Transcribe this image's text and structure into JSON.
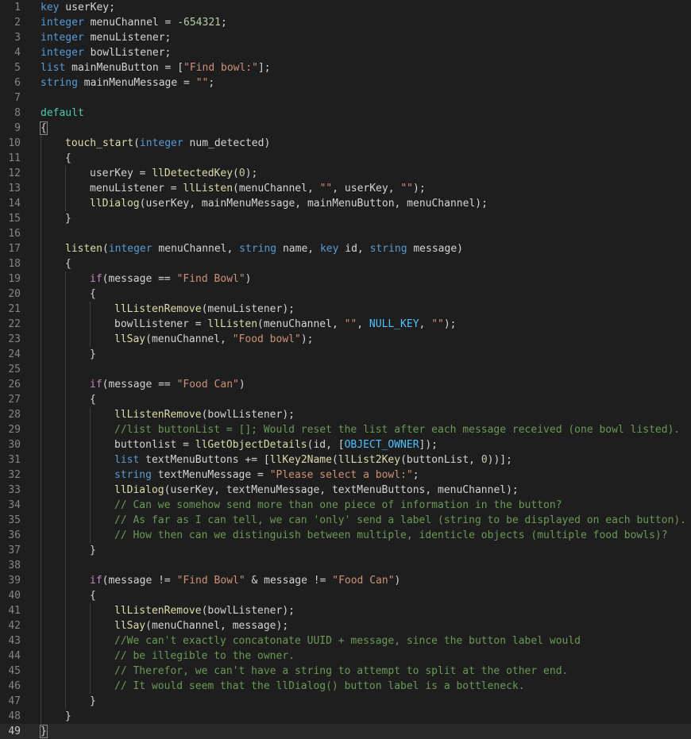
{
  "editor": {
    "language": "LSL",
    "colors": {
      "background": "#1e1e1e",
      "line_number": "#858585",
      "keyword_type": "#569cd6",
      "control": "#c586c0",
      "function": "#dcdcaa",
      "string": "#ce9178",
      "number": "#b5cea8",
      "comment": "#6a9955",
      "constant": "#4fc1ff",
      "state": "#4ec9b0"
    },
    "current_line": 49,
    "lines": [
      {
        "n": "1",
        "indent": 0,
        "tokens": [
          [
            "kw",
            "key"
          ],
          [
            "plain",
            " userKey;"
          ]
        ]
      },
      {
        "n": "2",
        "indent": 0,
        "tokens": [
          [
            "kw",
            "integer"
          ],
          [
            "plain",
            " menuChannel = "
          ],
          [
            "num",
            "-654321"
          ],
          [
            "plain",
            ";"
          ]
        ]
      },
      {
        "n": "3",
        "indent": 0,
        "tokens": [
          [
            "kw",
            "integer"
          ],
          [
            "plain",
            " menuListener;"
          ]
        ]
      },
      {
        "n": "4",
        "indent": 0,
        "tokens": [
          [
            "kw",
            "integer"
          ],
          [
            "plain",
            " bowlListener;"
          ]
        ]
      },
      {
        "n": "5",
        "indent": 0,
        "tokens": [
          [
            "kw",
            "list"
          ],
          [
            "plain",
            " mainMenuButton = ["
          ],
          [
            "str",
            "\"Find bowl:\""
          ],
          [
            "plain",
            "];"
          ]
        ]
      },
      {
        "n": "6",
        "indent": 0,
        "tokens": [
          [
            "kw",
            "string"
          ],
          [
            "plain",
            " mainMenuMessage = "
          ],
          [
            "str",
            "\"\""
          ],
          [
            "plain",
            ";"
          ]
        ]
      },
      {
        "n": "7",
        "indent": 0,
        "tokens": []
      },
      {
        "n": "8",
        "indent": 0,
        "tokens": [
          [
            "state",
            "default"
          ]
        ]
      },
      {
        "n": "9",
        "indent": 0,
        "tokens": [
          [
            "plain",
            "{"
          ]
        ],
        "match": true
      },
      {
        "n": "10",
        "indent": 1,
        "tokens": [
          [
            "ev",
            "touch_start"
          ],
          [
            "plain",
            "("
          ],
          [
            "kw",
            "integer"
          ],
          [
            "plain",
            " num_detected)"
          ]
        ]
      },
      {
        "n": "11",
        "indent": 1,
        "tokens": [
          [
            "plain",
            "{"
          ]
        ]
      },
      {
        "n": "12",
        "indent": 2,
        "tokens": [
          [
            "plain",
            "userKey = "
          ],
          [
            "fn",
            "llDetectedKey"
          ],
          [
            "plain",
            "("
          ],
          [
            "num",
            "0"
          ],
          [
            "plain",
            ");"
          ]
        ]
      },
      {
        "n": "13",
        "indent": 2,
        "tokens": [
          [
            "plain",
            "menuListener = "
          ],
          [
            "fn",
            "llListen"
          ],
          [
            "plain",
            "(menuChannel, "
          ],
          [
            "str",
            "\"\""
          ],
          [
            "plain",
            ", userKey, "
          ],
          [
            "str",
            "\"\""
          ],
          [
            "plain",
            ");"
          ]
        ]
      },
      {
        "n": "14",
        "indent": 2,
        "tokens": [
          [
            "fn",
            "llDialog"
          ],
          [
            "plain",
            "(userKey, mainMenuMessage, mainMenuButton, menuChannel);"
          ]
        ]
      },
      {
        "n": "15",
        "indent": 1,
        "tokens": [
          [
            "plain",
            "}"
          ]
        ]
      },
      {
        "n": "16",
        "indent": 0,
        "guides": 1,
        "tokens": []
      },
      {
        "n": "17",
        "indent": 1,
        "tokens": [
          [
            "ev",
            "listen"
          ],
          [
            "plain",
            "("
          ],
          [
            "kw",
            "integer"
          ],
          [
            "plain",
            " menuChannel, "
          ],
          [
            "kw",
            "string"
          ],
          [
            "plain",
            " name, "
          ],
          [
            "kw",
            "key"
          ],
          [
            "plain",
            " id, "
          ],
          [
            "kw",
            "string"
          ],
          [
            "plain",
            " message)"
          ]
        ]
      },
      {
        "n": "18",
        "indent": 1,
        "tokens": [
          [
            "plain",
            "{"
          ]
        ]
      },
      {
        "n": "19",
        "indent": 2,
        "tokens": [
          [
            "ctl",
            "if"
          ],
          [
            "plain",
            "(message == "
          ],
          [
            "str",
            "\"Find Bowl\""
          ],
          [
            "plain",
            ")"
          ]
        ]
      },
      {
        "n": "20",
        "indent": 2,
        "tokens": [
          [
            "plain",
            "{"
          ]
        ]
      },
      {
        "n": "21",
        "indent": 3,
        "tokens": [
          [
            "fn",
            "llListenRemove"
          ],
          [
            "plain",
            "(menuListener);"
          ]
        ]
      },
      {
        "n": "22",
        "indent": 3,
        "tokens": [
          [
            "plain",
            "bowlListener = "
          ],
          [
            "fn",
            "llListen"
          ],
          [
            "plain",
            "(menuChannel, "
          ],
          [
            "str",
            "\"\""
          ],
          [
            "plain",
            ", "
          ],
          [
            "const",
            "NULL_KEY"
          ],
          [
            "plain",
            ", "
          ],
          [
            "str",
            "\"\""
          ],
          [
            "plain",
            ");"
          ]
        ]
      },
      {
        "n": "23",
        "indent": 3,
        "tokens": [
          [
            "fn",
            "llSay"
          ],
          [
            "plain",
            "(menuChannel, "
          ],
          [
            "str",
            "\"Food bowl\""
          ],
          [
            "plain",
            ");"
          ]
        ]
      },
      {
        "n": "24",
        "indent": 2,
        "tokens": [
          [
            "plain",
            "}"
          ]
        ]
      },
      {
        "n": "25",
        "indent": 0,
        "guides": 2,
        "tokens": []
      },
      {
        "n": "26",
        "indent": 2,
        "tokens": [
          [
            "ctl",
            "if"
          ],
          [
            "plain",
            "(message == "
          ],
          [
            "str",
            "\"Food Can\""
          ],
          [
            "plain",
            ")"
          ]
        ]
      },
      {
        "n": "27",
        "indent": 2,
        "tokens": [
          [
            "plain",
            "{"
          ]
        ]
      },
      {
        "n": "28",
        "indent": 3,
        "tokens": [
          [
            "fn",
            "llListenRemove"
          ],
          [
            "plain",
            "(bowlListener);"
          ]
        ]
      },
      {
        "n": "29",
        "indent": 3,
        "tokens": [
          [
            "cmt",
            "//list buttonList = []; Would reset the list after each message received (one bowl listed)."
          ]
        ]
      },
      {
        "n": "30",
        "indent": 3,
        "tokens": [
          [
            "plain",
            "buttonlist = "
          ],
          [
            "fn",
            "llGetObjectDetails"
          ],
          [
            "plain",
            "(id, ["
          ],
          [
            "const",
            "OBJECT_OWNER"
          ],
          [
            "plain",
            "]);"
          ]
        ]
      },
      {
        "n": "31",
        "indent": 3,
        "tokens": [
          [
            "kw",
            "list"
          ],
          [
            "plain",
            " textMenuButtons += ["
          ],
          [
            "fn",
            "llKey2Name"
          ],
          [
            "plain",
            "("
          ],
          [
            "fn",
            "llList2Key"
          ],
          [
            "plain",
            "(buttonList, "
          ],
          [
            "num",
            "0"
          ],
          [
            "plain",
            "))];"
          ]
        ]
      },
      {
        "n": "32",
        "indent": 3,
        "tokens": [
          [
            "kw",
            "string"
          ],
          [
            "plain",
            " textMenuMessage = "
          ],
          [
            "str",
            "\"Please select a bowl:\""
          ],
          [
            "plain",
            ";"
          ]
        ]
      },
      {
        "n": "33",
        "indent": 3,
        "tokens": [
          [
            "fn",
            "llDialog"
          ],
          [
            "plain",
            "(userKey, textMenuMessage, textMenuButtons, menuChannel);"
          ]
        ]
      },
      {
        "n": "34",
        "indent": 3,
        "tokens": [
          [
            "cmt",
            "// Can we somehow send more than one piece of information in the button?"
          ]
        ]
      },
      {
        "n": "35",
        "indent": 3,
        "tokens": [
          [
            "cmt",
            "// As far as I can tell, we can 'only' send a label (string to be displayed on each button)."
          ]
        ]
      },
      {
        "n": "36",
        "indent": 3,
        "tokens": [
          [
            "cmt",
            "// How then can we distinguish between multiple, identicle objects (multiple food bowls)?"
          ]
        ]
      },
      {
        "n": "37",
        "indent": 2,
        "tokens": [
          [
            "plain",
            "}"
          ]
        ]
      },
      {
        "n": "38",
        "indent": 0,
        "guides": 2,
        "tokens": []
      },
      {
        "n": "39",
        "indent": 2,
        "tokens": [
          [
            "ctl",
            "if"
          ],
          [
            "plain",
            "(message != "
          ],
          [
            "str",
            "\"Find Bowl\""
          ],
          [
            "plain",
            " & message != "
          ],
          [
            "str",
            "\"Food Can\""
          ],
          [
            "plain",
            ")"
          ]
        ]
      },
      {
        "n": "40",
        "indent": 2,
        "tokens": [
          [
            "plain",
            "{"
          ]
        ]
      },
      {
        "n": "41",
        "indent": 3,
        "tokens": [
          [
            "fn",
            "llListenRemove"
          ],
          [
            "plain",
            "(bowlListener);"
          ]
        ]
      },
      {
        "n": "42",
        "indent": 3,
        "tokens": [
          [
            "fn",
            "llSay"
          ],
          [
            "plain",
            "(menuChannel, message);"
          ]
        ]
      },
      {
        "n": "43",
        "indent": 3,
        "tokens": [
          [
            "cmt",
            "//We can't exactly concatonate UUID + message, since the button label would"
          ]
        ]
      },
      {
        "n": "44",
        "indent": 3,
        "tokens": [
          [
            "cmt",
            "// be illegible to the owner."
          ]
        ]
      },
      {
        "n": "45",
        "indent": 3,
        "tokens": [
          [
            "cmt",
            "// Therefor, we can't have a string to attempt to split at the other end."
          ]
        ]
      },
      {
        "n": "46",
        "indent": 3,
        "tokens": [
          [
            "cmt",
            "// It would seem that the llDialog() button label is a bottleneck."
          ]
        ]
      },
      {
        "n": "47",
        "indent": 2,
        "tokens": [
          [
            "plain",
            "}"
          ]
        ]
      },
      {
        "n": "48",
        "indent": 1,
        "tokens": [
          [
            "plain",
            "}"
          ]
        ]
      },
      {
        "n": "49",
        "indent": 0,
        "tokens": [
          [
            "plain",
            "}"
          ]
        ],
        "match": true
      }
    ]
  }
}
